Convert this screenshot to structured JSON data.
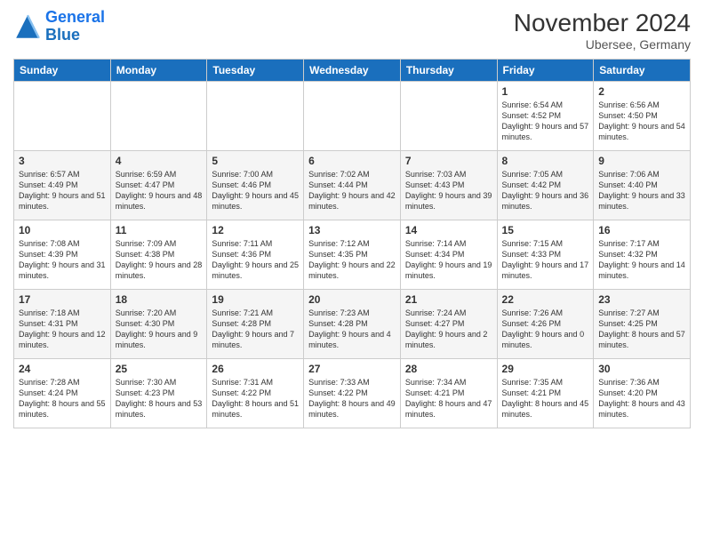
{
  "logo": {
    "line1": "General",
    "line2": "Blue"
  },
  "title": "November 2024",
  "subtitle": "Ubersee, Germany",
  "days_of_week": [
    "Sunday",
    "Monday",
    "Tuesday",
    "Wednesday",
    "Thursday",
    "Friday",
    "Saturday"
  ],
  "weeks": [
    [
      {
        "day": "",
        "info": ""
      },
      {
        "day": "",
        "info": ""
      },
      {
        "day": "",
        "info": ""
      },
      {
        "day": "",
        "info": ""
      },
      {
        "day": "",
        "info": ""
      },
      {
        "day": "1",
        "info": "Sunrise: 6:54 AM\nSunset: 4:52 PM\nDaylight: 9 hours\nand 57 minutes."
      },
      {
        "day": "2",
        "info": "Sunrise: 6:56 AM\nSunset: 4:50 PM\nDaylight: 9 hours\nand 54 minutes."
      }
    ],
    [
      {
        "day": "3",
        "info": "Sunrise: 6:57 AM\nSunset: 4:49 PM\nDaylight: 9 hours\nand 51 minutes."
      },
      {
        "day": "4",
        "info": "Sunrise: 6:59 AM\nSunset: 4:47 PM\nDaylight: 9 hours\nand 48 minutes."
      },
      {
        "day": "5",
        "info": "Sunrise: 7:00 AM\nSunset: 4:46 PM\nDaylight: 9 hours\nand 45 minutes."
      },
      {
        "day": "6",
        "info": "Sunrise: 7:02 AM\nSunset: 4:44 PM\nDaylight: 9 hours\nand 42 minutes."
      },
      {
        "day": "7",
        "info": "Sunrise: 7:03 AM\nSunset: 4:43 PM\nDaylight: 9 hours\nand 39 minutes."
      },
      {
        "day": "8",
        "info": "Sunrise: 7:05 AM\nSunset: 4:42 PM\nDaylight: 9 hours\nand 36 minutes."
      },
      {
        "day": "9",
        "info": "Sunrise: 7:06 AM\nSunset: 4:40 PM\nDaylight: 9 hours\nand 33 minutes."
      }
    ],
    [
      {
        "day": "10",
        "info": "Sunrise: 7:08 AM\nSunset: 4:39 PM\nDaylight: 9 hours\nand 31 minutes."
      },
      {
        "day": "11",
        "info": "Sunrise: 7:09 AM\nSunset: 4:38 PM\nDaylight: 9 hours\nand 28 minutes."
      },
      {
        "day": "12",
        "info": "Sunrise: 7:11 AM\nSunset: 4:36 PM\nDaylight: 9 hours\nand 25 minutes."
      },
      {
        "day": "13",
        "info": "Sunrise: 7:12 AM\nSunset: 4:35 PM\nDaylight: 9 hours\nand 22 minutes."
      },
      {
        "day": "14",
        "info": "Sunrise: 7:14 AM\nSunset: 4:34 PM\nDaylight: 9 hours\nand 19 minutes."
      },
      {
        "day": "15",
        "info": "Sunrise: 7:15 AM\nSunset: 4:33 PM\nDaylight: 9 hours\nand 17 minutes."
      },
      {
        "day": "16",
        "info": "Sunrise: 7:17 AM\nSunset: 4:32 PM\nDaylight: 9 hours\nand 14 minutes."
      }
    ],
    [
      {
        "day": "17",
        "info": "Sunrise: 7:18 AM\nSunset: 4:31 PM\nDaylight: 9 hours\nand 12 minutes."
      },
      {
        "day": "18",
        "info": "Sunrise: 7:20 AM\nSunset: 4:30 PM\nDaylight: 9 hours\nand 9 minutes."
      },
      {
        "day": "19",
        "info": "Sunrise: 7:21 AM\nSunset: 4:28 PM\nDaylight: 9 hours\nand 7 minutes."
      },
      {
        "day": "20",
        "info": "Sunrise: 7:23 AM\nSunset: 4:28 PM\nDaylight: 9 hours\nand 4 minutes."
      },
      {
        "day": "21",
        "info": "Sunrise: 7:24 AM\nSunset: 4:27 PM\nDaylight: 9 hours\nand 2 minutes."
      },
      {
        "day": "22",
        "info": "Sunrise: 7:26 AM\nSunset: 4:26 PM\nDaylight: 9 hours\nand 0 minutes."
      },
      {
        "day": "23",
        "info": "Sunrise: 7:27 AM\nSunset: 4:25 PM\nDaylight: 8 hours\nand 57 minutes."
      }
    ],
    [
      {
        "day": "24",
        "info": "Sunrise: 7:28 AM\nSunset: 4:24 PM\nDaylight: 8 hours\nand 55 minutes."
      },
      {
        "day": "25",
        "info": "Sunrise: 7:30 AM\nSunset: 4:23 PM\nDaylight: 8 hours\nand 53 minutes."
      },
      {
        "day": "26",
        "info": "Sunrise: 7:31 AM\nSunset: 4:22 PM\nDaylight: 8 hours\nand 51 minutes."
      },
      {
        "day": "27",
        "info": "Sunrise: 7:33 AM\nSunset: 4:22 PM\nDaylight: 8 hours\nand 49 minutes."
      },
      {
        "day": "28",
        "info": "Sunrise: 7:34 AM\nSunset: 4:21 PM\nDaylight: 8 hours\nand 47 minutes."
      },
      {
        "day": "29",
        "info": "Sunrise: 7:35 AM\nSunset: 4:21 PM\nDaylight: 8 hours\nand 45 minutes."
      },
      {
        "day": "30",
        "info": "Sunrise: 7:36 AM\nSunset: 4:20 PM\nDaylight: 8 hours\nand 43 minutes."
      }
    ]
  ]
}
